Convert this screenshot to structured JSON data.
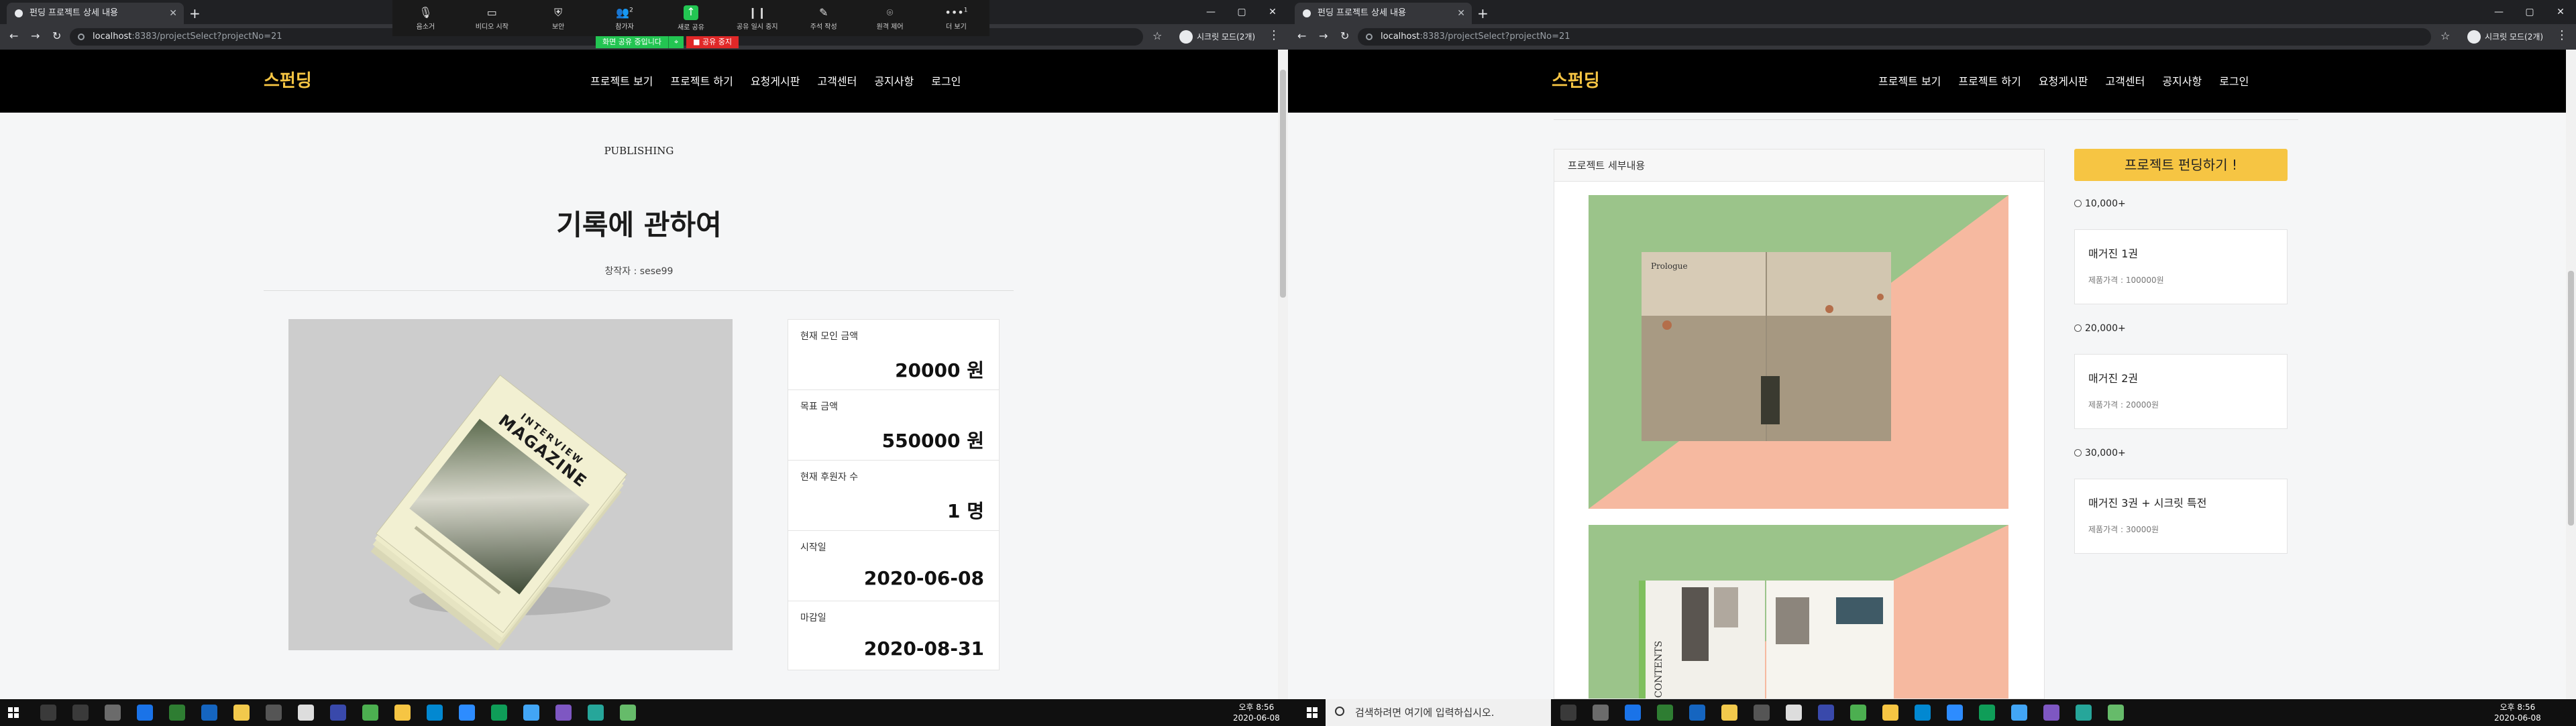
{
  "browser": {
    "tab_title": "펀딩 프로젝트 상세 내용",
    "url_host": "localhost",
    "url_path": ":8383/projectSelect?projectNo=21",
    "profile_label": "시크릿 모드(2개)"
  },
  "zoom": {
    "buttons": [
      {
        "label": "음소거",
        "icon": "mic-icon"
      },
      {
        "label": "비디오 시작",
        "icon": "video-icon"
      },
      {
        "label": "보안",
        "icon": "shield-icon"
      },
      {
        "label": "참가자",
        "icon": "participants-icon",
        "badge": "2"
      },
      {
        "label": "새로 공유",
        "icon": "share-icon"
      },
      {
        "label": "공유 일시 중지",
        "icon": "pause-icon"
      },
      {
        "label": "주석 작성",
        "icon": "pen-icon"
      },
      {
        "label": "원격 제어",
        "icon": "mouse-icon"
      },
      {
        "label": "더 보기",
        "icon": "more-icon",
        "badge": "1"
      }
    ],
    "sharing_text": "화면 공유 중입니다",
    "stop_label": "공유 중지"
  },
  "site": {
    "logo": "스펀딩",
    "nav": [
      "프로젝트 보기",
      "프로젝트 하기",
      "요청게시판",
      "고객센터",
      "공지사항",
      "로그인"
    ]
  },
  "project": {
    "category": "PUBLISHING",
    "title": "기록에 관하여",
    "creator": "창작자 : sese99",
    "stats": [
      {
        "label": "현재 모인 금액",
        "value": "20000 원"
      },
      {
        "label": "목표 금액",
        "value": "550000 원"
      },
      {
        "label": "현재 후원자 수",
        "value": "1 명"
      },
      {
        "label": "시작일",
        "value": "2020-06-08"
      },
      {
        "label": "마감일",
        "value": "2020-08-31"
      }
    ],
    "cover_text_1": "INTERVIEW",
    "cover_text_2": "MAGAZINE"
  },
  "detail": {
    "header": "프로젝트 세부내용",
    "page1_heading": "Prologue",
    "page2_heading": "CONTENTS"
  },
  "funding": {
    "button": "프로젝트 펀딩하기 !",
    "tiers": [
      {
        "amount": "10,000+",
        "name": "매거진 1권",
        "price": "제품가격 : 100000원"
      },
      {
        "amount": "20,000+",
        "name": "매거진 2권",
        "price": "제품가격 : 20000원"
      },
      {
        "amount": "30,000+",
        "name": "매거진 3권 + 시크릿 특전",
        "price": "제품가격 : 30000원"
      }
    ]
  },
  "taskbar": {
    "search_placeholder": "검색하려면 여기에 입력하십시오.",
    "time": "오후 8:56",
    "date": "2020-06-08"
  },
  "colors": {
    "accent": "#f6c543",
    "zoom_green": "#23c552",
    "zoom_red": "#e02828"
  }
}
